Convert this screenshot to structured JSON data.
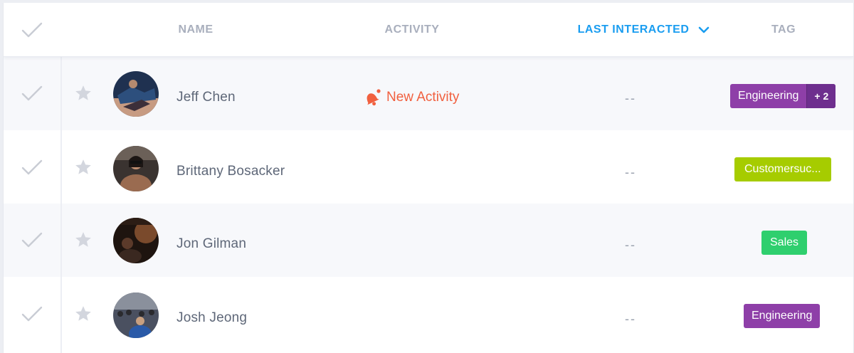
{
  "header": {
    "columns": {
      "name": "NAME",
      "activity": "ACTIVITY",
      "last_interacted": "LAST INTERACTED",
      "tag": "TAG"
    },
    "sort_column": "last_interacted",
    "sort_icon": "chevron-down-icon"
  },
  "colors": {
    "accent": "#1a9df0",
    "activity": "#f1603f",
    "tag_engineering": "#8e3fa8",
    "tag_customersuccess": "#a6cc00",
    "tag_sales": "#2fcf6e"
  },
  "rows": [
    {
      "name": "Jeff Chen",
      "activity": "New Activity",
      "last_interacted": "--",
      "tag": "Engineering",
      "tag_more": "+ 2"
    },
    {
      "name": "Brittany Bosacker",
      "activity": "",
      "last_interacted": "--",
      "tag": "Customersuc..."
    },
    {
      "name": "Jon Gilman",
      "activity": "",
      "last_interacted": "--",
      "tag": "Sales"
    },
    {
      "name": "Josh Jeong",
      "activity": "",
      "last_interacted": "--",
      "tag": "Engineering"
    }
  ]
}
